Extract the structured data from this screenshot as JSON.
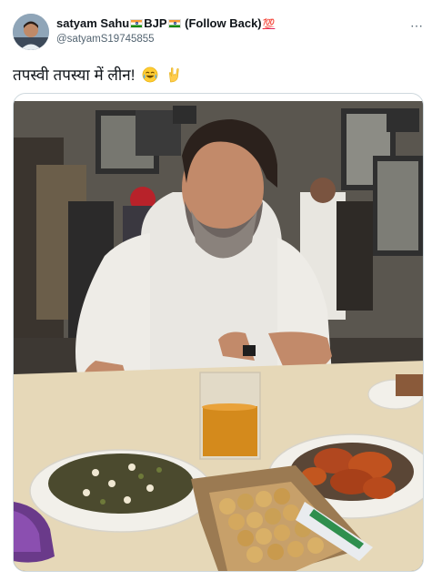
{
  "author": {
    "display_name_start": "satyam Sahu",
    "display_name_party": "BJP",
    "display_name_follow": "(Follow Back)",
    "hundred_emoji": "💯",
    "handle": "@satyamS19745855"
  },
  "tweet": {
    "text": "तपस्वी तपस्या में लीन!",
    "more_icon": "⋯"
  },
  "icons": {
    "more": "more-horizontal-icon",
    "emoji_1": "face-with-tears-of-joy",
    "emoji_2": "love-you-gesture-hand"
  },
  "colors": {
    "text": "#0f1419",
    "secondary": "#536471",
    "border": "#cfd9de"
  }
}
